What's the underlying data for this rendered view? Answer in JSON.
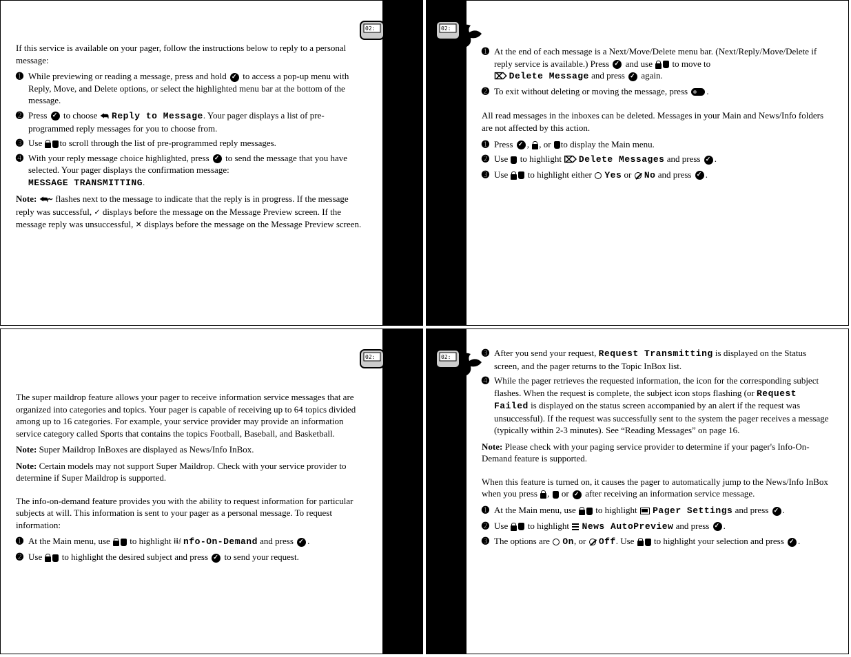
{
  "page1": {
    "intro": "If this service is available on your pager, follow the instructions below to reply to a personal message:",
    "step1_a": "While previewing or reading a message, press and hold ",
    "step1_b": " to access a pop-up menu with Reply, Move, and Delete options, or select the highlighted menu bar at the bottom of the message.",
    "step2_a": "Press ",
    "step2_b": " to choose ",
    "step2_label": "Reply to Message",
    "step2_c": ". Your pager displays a list of pre-programmed reply messages for you to choose from.",
    "step3_a": "Use ",
    "step3_b": "to scroll through the list of pre-programmed reply messages.",
    "step4_a": "With your reply message choice highlighted, press ",
    "step4_b": " to send the message that you have selected. Your pager displays the confirmation message: ",
    "step4_label": "MESSAGE TRANSMITTING",
    "note_label": "Note:",
    "note_text_a": " flashes next to the message to indicate that the reply is in progress. If the message reply was successful, ",
    "note_text_b": " displays before the message on the Message Preview screen. If the message reply was unsuccessful, ",
    "note_text_c": " displays before the message on the Message Preview screen."
  },
  "page2": {
    "step1_a": "At the end of each message is a Next/Move/Delete menu bar. (Next/Reply/Move/Delete if reply service is available.) Press ",
    "step1_b": " and use ",
    "step1_c": " to move to",
    "step1_label": "Delete Message",
    "step1_d": " and press ",
    "step1_e": " again.",
    "step2_a": "To exit without deleting or moving the message, press ",
    "step2_b": ".",
    "para2": "All read messages in the inboxes can be deleted. Messages in your Main and News/Info folders are not affected by this action.",
    "s2step1_a": "Press ",
    "s2step1_b": ", ",
    "s2step1_c": ", or ",
    "s2step1_d": "to display the Main menu.",
    "s2step2_a": "Use ",
    "s2step2_b": " to highlight ",
    "s2step2_label": "Delete Messages",
    "s2step2_c": " and press ",
    "s2step2_d": ".",
    "s2step3_a": "Use ",
    "s2step3_b": " to highlight either ",
    "s2step3_yes": "Yes",
    "s2step3_or": " or ",
    "s2step3_no": "No",
    "s2step3_c": " and press ",
    "s2step3_d": "."
  },
  "page3": {
    "para1": "The super maildrop feature allows your pager to receive information service messages that are organized into categories and topics. Your pager is capable of receiving up to 64 topics divided among up to 16 categories. For example, your service provider may provide an information service category called Sports that contains the topics Football, Baseball, and Basketball.",
    "note1_label": "Note:",
    "note1_text": " Super Maildrop InBoxes are displayed as News/Info InBox.",
    "note2_label": "Note:",
    "note2_text": " Certain models may not support Super Maildrop. Check with your service provider to determine if Super Maildrop is supported.",
    "para2": "The info-on-demand feature provides you with the ability to request information for particular subjects at will. This information is sent to your pager as a personal message. To request information:",
    "step1_a": "At the Main menu, use ",
    "step1_b": " to highlight ",
    "step1_label": "nfo-On-Demand",
    "step1_c": " and press ",
    "step1_d": ".",
    "step2_a": "Use ",
    "step2_b": " to highlight the desired subject and press ",
    "step2_c": " to send your request."
  },
  "page4": {
    "step3_a": "After you send your request, ",
    "step3_label": "Request Transmitting",
    "step3_b": " is displayed on the Status screen, and the pager returns to the Topic InBox list.",
    "step4_a": "While the pager retrieves the requested information, the icon for the corresponding subject flashes. When the request is complete, the subject icon stops flashing (or ",
    "step4_label": "Request Failed",
    "step4_b": " is displayed on the status screen accompanied by an alert if the request was unsuccessful). If the request was successfully sent to the system the pager receives a message (typically within 2-3 minutes). See “Reading Messages” on page 16.",
    "note_label": "Note:",
    "note_text": " Please check with your paging service provider to determine if your pager's Info-On-Demand feature is supported.",
    "para2_a": "When this feature is turned on, it causes the pager to automatically jump to the News/Info InBox when you press ",
    "para2_b": ", ",
    "para2_c": " or ",
    "para2_d": " after receiving an information service message.",
    "s2step1_a": "At the Main menu, use ",
    "s2step1_b": " to highlight ",
    "s2step1_label": "Pager Settings",
    "s2step1_c": " and press ",
    "s2step1_d": ".",
    "s2step2_a": "Use ",
    "s2step2_b": " to highlight ",
    "s2step2_label": "News AutoPreview",
    "s2step2_c": " and press ",
    "s2step2_d": ".",
    "s2step3_a": "The options are ",
    "s2step3_on": "On",
    "s2step3_mid": ", or ",
    "s2step3_off": "Off",
    "s2step3_b": ". Use ",
    "s2step3_c": " to highlight your selection and press ",
    "s2step3_d": "."
  }
}
